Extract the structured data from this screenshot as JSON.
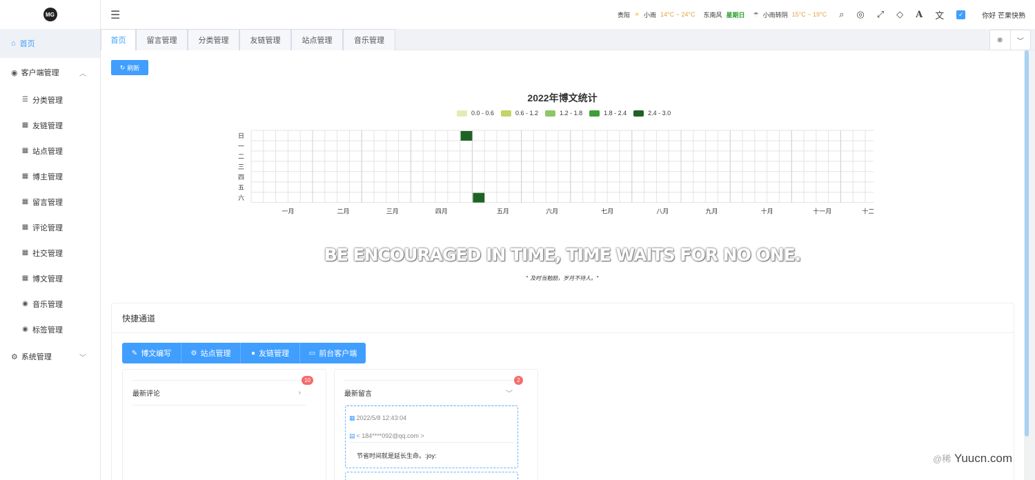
{
  "logo": {
    "text": "MG"
  },
  "sidebar": {
    "home": "首页",
    "group_client": "客户端管理",
    "items": [
      "分类管理",
      "友链管理",
      "站点管理",
      "博主管理",
      "留言管理",
      "评论管理",
      "社交管理",
      "博文管理",
      "音乐管理",
      "标签管理"
    ],
    "item_icons": [
      "list-icon",
      "grid-icon",
      "grid-icon",
      "grid-icon",
      "grid-icon",
      "grid-icon",
      "grid-icon",
      "grid-icon",
      "circle-icon",
      "circle-icon"
    ],
    "group_system": "系统管理"
  },
  "header": {
    "city": "贵阳",
    "today_weather": "小雨",
    "today_temp": "14°C ~ 24°C",
    "wind": "东南风",
    "weekday": "星期日",
    "tomorrow_weather": "小雨转阴",
    "tomorrow_temp": "15°C ~ 19°C",
    "greeting": "你好 芒果快熟",
    "icons": [
      "search-icon",
      "target-icon",
      "fullscreen-icon",
      "diamond-icon",
      "font-icon",
      "translate-icon",
      "checkbox-icon"
    ]
  },
  "tabs": [
    "首页",
    "留言管理",
    "分类管理",
    "友链管理",
    "站点管理",
    "音乐管理"
  ],
  "refresh_label": "刷新",
  "chart_data": {
    "type": "heatmap",
    "title": "2022年博文统计",
    "legend": [
      {
        "label": "0.0 - 0.6",
        "color": "#e5ebb5"
      },
      {
        "label": "0.6 - 1.2",
        "color": "#c2d569"
      },
      {
        "label": "1.2 - 1.8",
        "color": "#8dc764"
      },
      {
        "label": "1.8 - 2.4",
        "color": "#3f9e3a"
      },
      {
        "label": "2.4 - 3.0",
        "color": "#1e6324"
      }
    ],
    "day_labels": [
      "日",
      "一",
      "二",
      "三",
      "四",
      "五",
      "六"
    ],
    "month_labels": [
      "一月",
      "二月",
      "三月",
      "四月",
      "五月",
      "六月",
      "七月",
      "八月",
      "九月",
      "十月",
      "十一月",
      "十二月"
    ],
    "year": 2022,
    "filled_cells": [
      {
        "date": "2022-04-24",
        "value": 3
      },
      {
        "date": "2022-05-07",
        "value": 3
      }
    ]
  },
  "motto": {
    "en": "BE ENCOURAGED IN TIME, TIME WAITS FOR NO ONE.",
    "cn": "\" 及时当勉励，岁月不待人。\""
  },
  "quick": {
    "title": "快捷通道",
    "buttons": [
      "博文编写",
      "站点管理",
      "友链管理",
      "前台客户端"
    ],
    "button_icons": [
      "edit-icon",
      "gear-icon",
      "user-icon",
      "window-icon"
    ],
    "comments_title": "最新评论",
    "comments_badge": "10",
    "messages_title": "最新留言",
    "messages_badge": "2",
    "message": {
      "date": "2022/5/8 12:43:04",
      "email": "< 184****092@qq.com >",
      "text": "节省时间就是延长生命。:joy:"
    }
  },
  "watermark": {
    "faint": "@稀",
    "text": "Yuucn.com"
  }
}
